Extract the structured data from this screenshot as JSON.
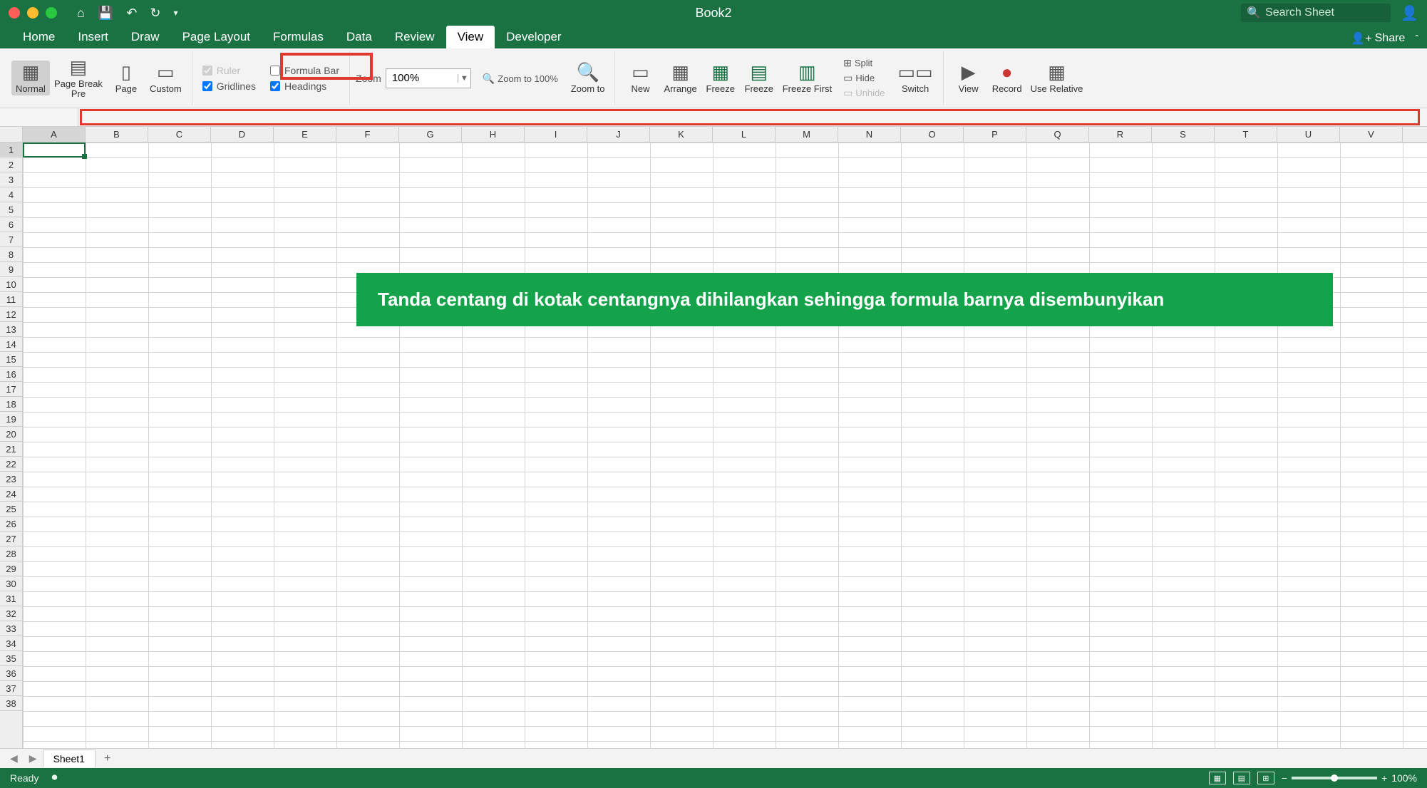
{
  "titlebar": {
    "title": "Book2",
    "search_placeholder": "Search Sheet"
  },
  "tabs": {
    "items": [
      "Home",
      "Insert",
      "Draw",
      "Page Layout",
      "Formulas",
      "Data",
      "Review",
      "View",
      "Developer"
    ],
    "active": "View",
    "share": "Share"
  },
  "ribbon": {
    "views": {
      "normal": "Normal",
      "page_break": "Page Break\nPre",
      "page": "Page",
      "custom": "Custom"
    },
    "show": {
      "ruler": "Ruler",
      "formula_bar": "Formula Bar",
      "gridlines": "Gridlines",
      "headings": "Headings"
    },
    "zoom": {
      "label": "Zoom",
      "value": "100%",
      "zoom_to_100": "Zoom to 100%",
      "zoom_to": "Zoom to"
    },
    "window": {
      "new": "New",
      "arrange": "Arrange",
      "freeze": "Freeze",
      "freeze2": "Freeze",
      "freeze_first": "Freeze First",
      "split": "Split",
      "hide": "Hide",
      "unhide": "Unhide",
      "switch": "Switch"
    },
    "macros": {
      "view": "View",
      "record": "Record",
      "use_relative": "Use Relative"
    }
  },
  "namebox": {
    "value": ""
  },
  "callout": "Tanda centang di kotak centangnya dihilangkan sehingga formula barnya disembunyikan",
  "columns": [
    "A",
    "B",
    "C",
    "D",
    "E",
    "F",
    "G",
    "H",
    "I",
    "J",
    "K",
    "L",
    "M",
    "N",
    "O",
    "P",
    "Q",
    "R",
    "S",
    "T",
    "U",
    "V"
  ],
  "rows": [
    "1",
    "2",
    "3",
    "4",
    "5",
    "6",
    "7",
    "8",
    "9",
    "10",
    "11",
    "12",
    "13",
    "14",
    "15",
    "16",
    "17",
    "18",
    "19",
    "20",
    "21",
    "22",
    "23",
    "24",
    "25",
    "26",
    "27",
    "28",
    "29",
    "30",
    "31",
    "32",
    "33",
    "34",
    "35",
    "36",
    "37",
    "38"
  ],
  "sheet": {
    "tab": "Sheet1"
  },
  "statusbar": {
    "ready": "Ready",
    "zoom": "100%"
  }
}
